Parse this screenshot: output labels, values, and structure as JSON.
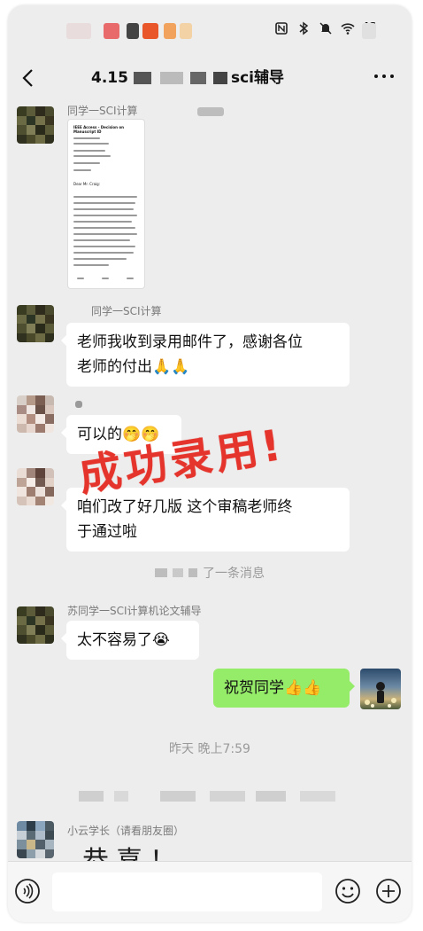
{
  "status_bar": {
    "icons": [
      "nfc-icon",
      "bluetooth-icon",
      "mute-icon",
      "wifi-icon",
      "signal-4g-icon"
    ],
    "network_label": "4G"
  },
  "navbar": {
    "title": "4.15",
    "title_tail": "sci辅导"
  },
  "messages": [
    {
      "id": "m1",
      "side": "left",
      "sender": "同学一SCI计算",
      "type": "image"
    },
    {
      "id": "m2",
      "side": "left",
      "sender": "同学一SCI计算",
      "text_l1": "老师我收到录用邮件了，感谢各位",
      "text_l2": "老师的付出🙏🙏"
    },
    {
      "id": "m3",
      "side": "left",
      "sender": "",
      "text": "可以的🤭🤭"
    },
    {
      "id": "m4",
      "side": "left",
      "sender": "",
      "text_l1": "咱们改了好几版 这个审稿老师终",
      "text_l2": "于通过啦"
    },
    {
      "id": "m5",
      "side": "left",
      "sender": "苏同学一SCI计算机论文辅导",
      "text": "太不容易了😭"
    },
    {
      "id": "m6",
      "side": "right",
      "text": "祝贺同学👍👍"
    },
    {
      "id": "m7",
      "side": "left",
      "sender": "小云学长（请看朋友圈）",
      "text": "恭喜！"
    }
  ],
  "document_image": {
    "heading": "IEEE Access - Decision on Manuscript ID",
    "greeting": "Dear Mr. Craig:"
  },
  "system_messages": {
    "recall": "了一条消息",
    "timestamp": "昨天 晚上7:59"
  },
  "stamp_text": "成功录用!",
  "input_bar": {
    "voice_icon": "voice-icon",
    "emoji_icon": "emoji-icon",
    "plus_icon": "plus-icon",
    "placeholder": ""
  },
  "colors": {
    "chat_bg": "#ededed",
    "bubble_self": "#95ec69",
    "bubble_other": "#ffffff",
    "stamp": "#e4342b"
  }
}
